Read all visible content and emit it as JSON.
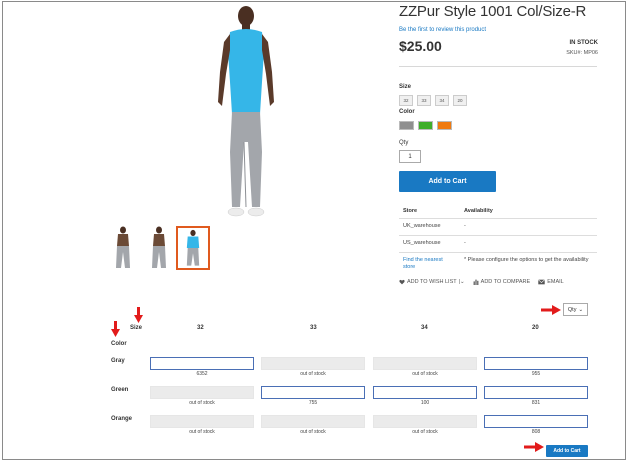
{
  "product": {
    "title": "ZZPur Style 1001 Col/Size-R",
    "review_link": "Be the first to review this product",
    "price": "$25.00",
    "stock": "IN STOCK",
    "sku": "SKU#:  MP06"
  },
  "options": {
    "size_label": "Size",
    "sizes": [
      "32",
      "33",
      "34",
      "20"
    ],
    "color_label": "Color",
    "colors": [
      "#8f8f8f",
      "#3fae2a",
      "#ef7a10"
    ],
    "qty_label": "Qty",
    "qty_value": "1"
  },
  "add_to_cart": "Add to Cart",
  "store_table": {
    "header_store": "Store",
    "header_availability": "Availability",
    "rows": [
      {
        "store": "UK_warehouse",
        "availability": "-"
      },
      {
        "store": "US_warehouse",
        "availability": "-"
      }
    ],
    "find_link": "Find the nearest store",
    "note": "* Please configure the options to get the availability"
  },
  "actions": {
    "wishlist": "ADD TO WISH LIST",
    "compare": "ADD TO COMPARE",
    "email": "EMAIL"
  },
  "matrix": {
    "qty_select": "Qty",
    "size_header": "Size",
    "color_header": "Color",
    "columns": [
      "32",
      "33",
      "34",
      "20"
    ],
    "rows": [
      {
        "color": "Gray",
        "cells": [
          {
            "state": "input",
            "note": "6352"
          },
          {
            "state": "disabled",
            "note": "out of stock"
          },
          {
            "state": "disabled",
            "note": "out of stock"
          },
          {
            "state": "input",
            "note": "955"
          }
        ]
      },
      {
        "color": "Green",
        "cells": [
          {
            "state": "disabled",
            "note": "out of stock"
          },
          {
            "state": "input",
            "note": "755"
          },
          {
            "state": "input",
            "note": "100"
          },
          {
            "state": "input",
            "note": "831"
          }
        ]
      },
      {
        "color": "Orange",
        "cells": [
          {
            "state": "disabled",
            "note": "out of stock"
          },
          {
            "state": "disabled",
            "note": "out of stock"
          },
          {
            "state": "disabled",
            "note": "out of stock"
          },
          {
            "state": "input",
            "note": "808"
          }
        ]
      }
    ],
    "add_to_cart": "Add to Cart"
  },
  "theme": {
    "accent": "#1979c3",
    "shirt": "#35b6e8",
    "pants": "#a3a6ab",
    "thumb_border": "#e05a1e",
    "annotation_arrow": "#e21b1b"
  }
}
